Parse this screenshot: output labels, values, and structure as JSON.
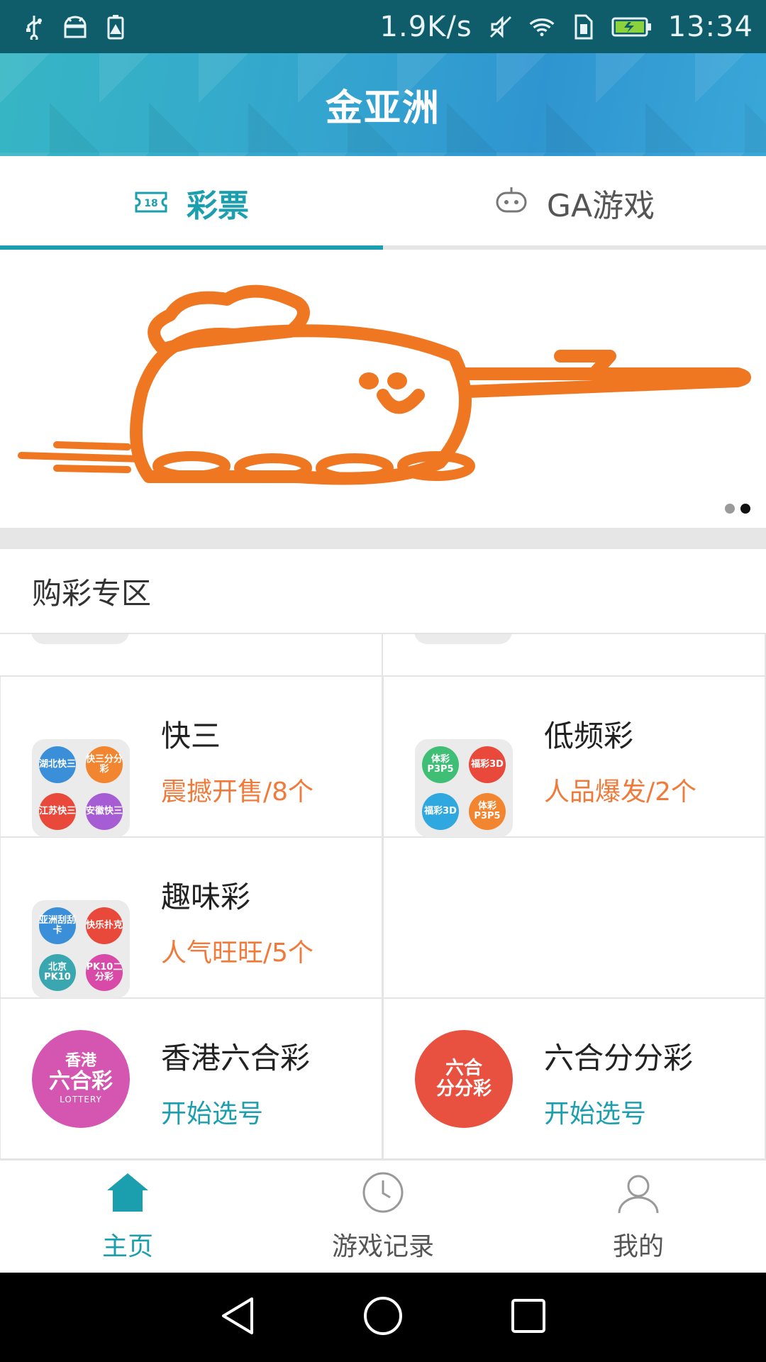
{
  "status_bar": {
    "net_speed": "1.9K/s",
    "time": "13:34",
    "icons": [
      "usb-icon",
      "android-debug-icon",
      "battery-alert-icon",
      "mute-icon",
      "wifi-icon",
      "sim-icon",
      "battery-charging-icon"
    ]
  },
  "header": {
    "title": "金亚洲"
  },
  "tabs": [
    {
      "label": "彩票",
      "icon": "ticket-18-icon",
      "active": true
    },
    {
      "label": "GA游戏",
      "icon": "robot-icon",
      "active": false
    }
  ],
  "banner": {
    "dots": 2,
    "active_dot": 1
  },
  "section": {
    "title": "购彩专区"
  },
  "lottery_items": [
    {
      "name": "快三",
      "subtitle": "震撼开售/8个",
      "subtitle_color": "#f07a3a",
      "badges": [
        "湖北快三",
        "快三分分彩",
        "江苏快三",
        "安徽快三"
      ]
    },
    {
      "name": "低频彩",
      "subtitle": "人品爆发/2个",
      "subtitle_color": "#f07a3a",
      "badges": [
        "体彩P3P5",
        "福彩3D",
        "福彩3D",
        "体彩P3P5"
      ]
    },
    {
      "name": "趣味彩",
      "subtitle": "人气旺旺/5个",
      "subtitle_color": "#f07a3a",
      "badges": [
        "亚洲刮刮卡",
        "快乐扑克",
        "北京PK10",
        "PK10二分彩"
      ]
    },
    {
      "name": "香港六合彩",
      "subtitle": "开始选号",
      "subtitle_color": "#1b9fae",
      "logo_line1": "香港",
      "logo_line2": "六合彩",
      "logo_line3": "LOTTERY"
    },
    {
      "name": "六合分分彩",
      "subtitle": "开始选号",
      "subtitle_color": "#1b9fae",
      "logo_line1": "六合",
      "logo_line2": "分分彩"
    }
  ],
  "bottom_nav": [
    {
      "label": "主页",
      "icon": "home-icon",
      "active": true
    },
    {
      "label": "游戏记录",
      "icon": "clock-icon",
      "active": false
    },
    {
      "label": "我的",
      "icon": "user-icon",
      "active": false
    }
  ],
  "colors": {
    "accent": "#1b9fae",
    "orange": "#f07a3a"
  }
}
